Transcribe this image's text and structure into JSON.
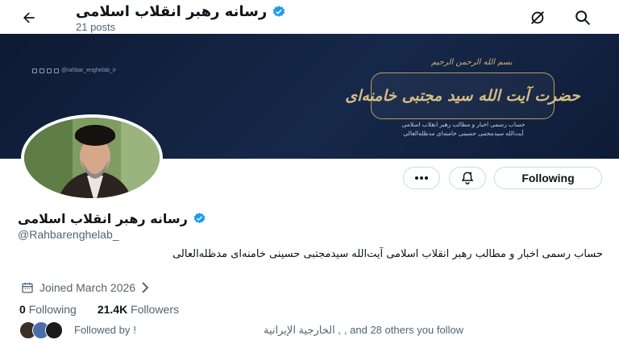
{
  "header": {
    "title": "رسانه رهبر انقلاب اسلامی",
    "posts_count": "21 posts",
    "back_icon": "arrow-left-icon",
    "grok_icon": "grok-icon",
    "search_icon": "search-icon"
  },
  "banner": {
    "handle": "@rahbar_enghelab_ir",
    "bismillah": "بسم الله الرحمن الرحیم",
    "calligraphy": "حضرت آیت الله سید مجتبی خامنه‌ای",
    "subtitle_line1": "حساب رسمی اخبار و مطالب رهبر انقلاب اسلامی",
    "subtitle_line2": "آیت‌الله سیدمجتبی حسینی خامنه‌ای مدظله‌العالی"
  },
  "actions": {
    "more_icon": "more-dots-icon",
    "notify_icon": "notification-bell-icon",
    "following_label": "Following"
  },
  "profile": {
    "display_name": "رسانه رهبر انقلاب اسلامی",
    "verified_icon": "verified-badge-icon",
    "handle": "@Rahbarenghelab_",
    "bio": "حساب رسمی اخبار و مطالب رهبر انقلاب اسلامی آیت‌الله سیدمجتبی حسینی خامنه‌ای مدظله‌العالی",
    "joined": "Joined March 2026",
    "following_count": "0",
    "following_label": "Following",
    "followers_count": "21.4K",
    "followers_label": "Followers",
    "followed_by_prefix": "Followed by",
    "followed_by_name1": "!",
    "followed_by_name2": "الخارجية الإيرانية ,",
    "followed_by_suffix": ", and 28 others you follow"
  },
  "colors": {
    "verified": "#1d9bf0",
    "banner_bg": "#12213f",
    "gold": "#c9b27a"
  }
}
